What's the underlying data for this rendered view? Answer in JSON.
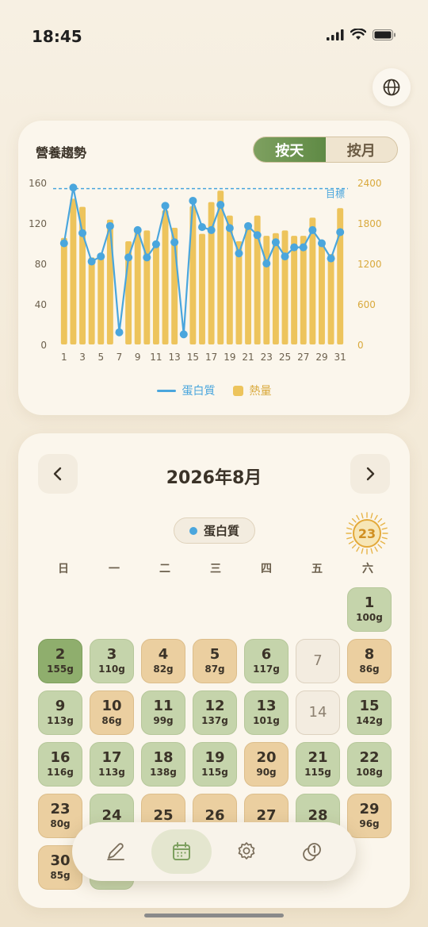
{
  "status": {
    "time": "18:45"
  },
  "trend": {
    "title": "營養趨勢",
    "seg_day": "按天",
    "seg_month": "按月",
    "legend_protein": "蛋白質",
    "legend_calorie": "熱量"
  },
  "chart_data": {
    "type": "bar",
    "x": [
      1,
      2,
      3,
      4,
      5,
      6,
      7,
      8,
      9,
      10,
      11,
      12,
      13,
      14,
      15,
      16,
      17,
      18,
      19,
      20,
      21,
      22,
      23,
      24,
      25,
      26,
      27,
      28,
      29,
      30,
      31
    ],
    "x_ticks": [
      "1",
      "3",
      "5",
      "7",
      "9",
      "11",
      "13",
      "15",
      "17",
      "19",
      "21",
      "23",
      "25",
      "27",
      "29",
      "31"
    ],
    "series": [
      {
        "name": "熱量",
        "axis": "right",
        "type": "bar",
        "values": [
          1580,
          2160,
          2040,
          1290,
          1340,
          1850,
          0,
          1530,
          1720,
          1690,
          1460,
          1990,
          1730,
          0,
          2050,
          1640,
          2110,
          2280,
          1910,
          1530,
          1720,
          1910,
          1610,
          1650,
          1690,
          1610,
          1610,
          1880,
          1530,
          1340,
          2020
        ]
      },
      {
        "name": "蛋白質",
        "axis": "left",
        "type": "line",
        "values": [
          100,
          155,
          110,
          82,
          87,
          117,
          12,
          86,
          113,
          86,
          99,
          137,
          101,
          10,
          142,
          116,
          113,
          138,
          115,
          90,
          117,
          108,
          80,
          101,
          87,
          96,
          96,
          113,
          100,
          85,
          111
        ]
      }
    ],
    "target_label": "目標",
    "target_value_left": 154,
    "left_axis": {
      "ticks": [
        "0",
        "40",
        "80",
        "120",
        "160"
      ],
      "ylim": [
        0,
        160
      ]
    },
    "right_axis": {
      "ticks": [
        "0",
        "600",
        "1200",
        "1800",
        "2400"
      ],
      "ylim": [
        0,
        2400
      ]
    },
    "colors": {
      "protein": "#4aa6dd",
      "calorie": "#edc45c",
      "left_axis": "#6b5f4c",
      "right_axis": "#d9a93c"
    }
  },
  "calendar": {
    "month_title": "2026年8月",
    "prev": "‹",
    "next": "›",
    "metric": "蛋白質",
    "target": "23",
    "weekdays": [
      "日",
      "一",
      "二",
      "三",
      "四",
      "五",
      "六"
    ],
    "days": [
      {
        "n": "1",
        "v": "100g",
        "s": "green"
      },
      {
        "n": "2",
        "v": "155g",
        "s": "dark"
      },
      {
        "n": "3",
        "v": "110g",
        "s": "green"
      },
      {
        "n": "4",
        "v": "82g",
        "s": "tan"
      },
      {
        "n": "5",
        "v": "87g",
        "s": "tan"
      },
      {
        "n": "6",
        "v": "117g",
        "s": "green"
      },
      {
        "n": "7",
        "v": "",
        "s": "empty"
      },
      {
        "n": "8",
        "v": "86g",
        "s": "tan"
      },
      {
        "n": "9",
        "v": "113g",
        "s": "green"
      },
      {
        "n": "10",
        "v": "86g",
        "s": "tan"
      },
      {
        "n": "11",
        "v": "99g",
        "s": "green"
      },
      {
        "n": "12",
        "v": "137g",
        "s": "green"
      },
      {
        "n": "13",
        "v": "101g",
        "s": "green"
      },
      {
        "n": "14",
        "v": "",
        "s": "empty"
      },
      {
        "n": "15",
        "v": "142g",
        "s": "green"
      },
      {
        "n": "16",
        "v": "116g",
        "s": "green"
      },
      {
        "n": "17",
        "v": "113g",
        "s": "green"
      },
      {
        "n": "18",
        "v": "138g",
        "s": "green"
      },
      {
        "n": "19",
        "v": "115g",
        "s": "green"
      },
      {
        "n": "20",
        "v": "90g",
        "s": "tan"
      },
      {
        "n": "21",
        "v": "115g",
        "s": "green"
      },
      {
        "n": "22",
        "v": "108g",
        "s": "green"
      },
      {
        "n": "23",
        "v": "80g",
        "s": "tan"
      },
      {
        "n": "24",
        "v": "",
        "s": "green"
      },
      {
        "n": "25",
        "v": "",
        "s": "tan"
      },
      {
        "n": "26",
        "v": "",
        "s": "tan"
      },
      {
        "n": "27",
        "v": "",
        "s": "tan"
      },
      {
        "n": "28",
        "v": "",
        "s": "green"
      },
      {
        "n": "29",
        "v": "96g",
        "s": "tan"
      },
      {
        "n": "30",
        "v": "85g",
        "s": "tan"
      },
      {
        "n": "31",
        "v": "",
        "s": "green"
      }
    ]
  },
  "nav": {
    "items": [
      "edit-icon",
      "calendar-icon",
      "settings-icon",
      "history-icon"
    ],
    "active": "calendar-icon"
  }
}
